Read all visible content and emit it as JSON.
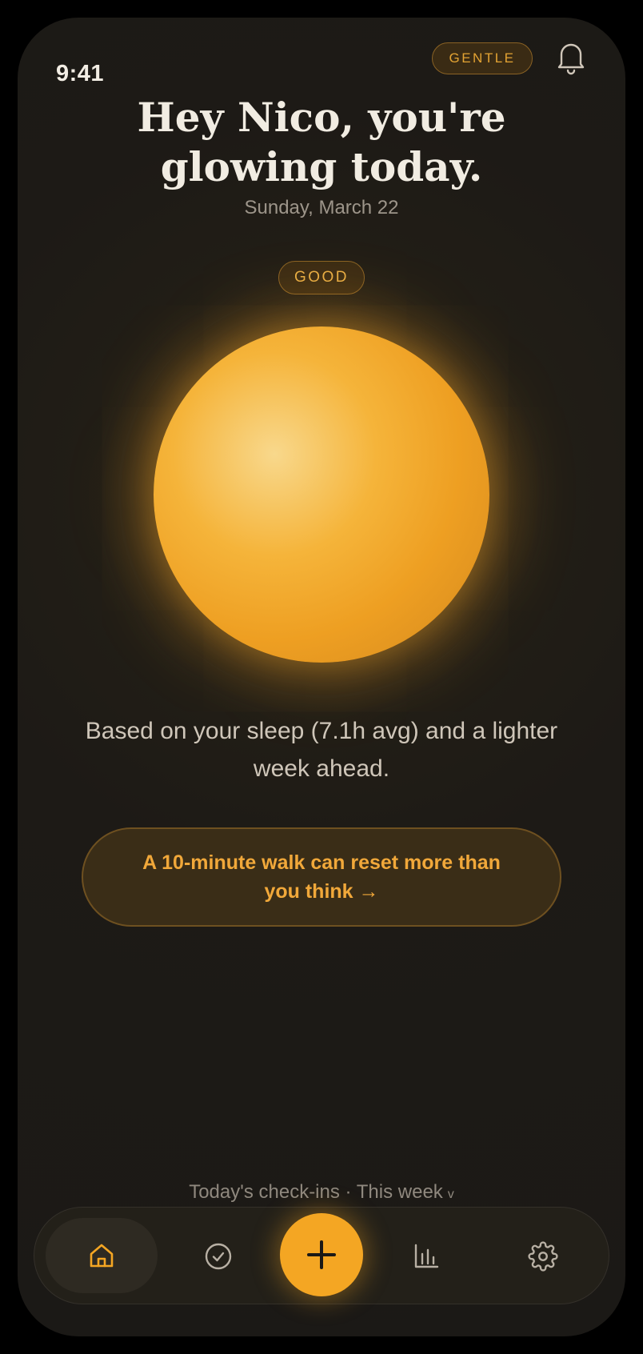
{
  "status_bar": {
    "time": "9:41"
  },
  "header": {
    "mode_badge": "GENTLE",
    "greeting_line1": "Hey Nico, you're",
    "greeting_line2": "glowing today.",
    "date": "Sunday, March 22"
  },
  "mood": {
    "label": "GOOD",
    "orb_colors": {
      "core": "#f8d88c",
      "mid": "#f5b43a",
      "edge": "#d3881e"
    }
  },
  "insight_text": "Based on your sleep (7.1h avg) and a lighter week ahead.",
  "tip": {
    "label": "A 10-minute walk can reset more than you think →"
  },
  "checkins": {
    "label": "Today's check-ins · This week",
    "chevron": "v"
  },
  "nav": {
    "items": [
      {
        "icon": "home-icon",
        "active": true
      },
      {
        "icon": "check-circle-icon",
        "active": false
      },
      {
        "icon": "plus-icon",
        "primary": true
      },
      {
        "icon": "bar-chart-icon",
        "active": false
      },
      {
        "icon": "gear-icon",
        "active": false
      }
    ]
  },
  "colors": {
    "accent": "#f4a623",
    "background": "#1b1916",
    "text_primary": "#f1ece2",
    "text_muted": "#9d958a"
  }
}
